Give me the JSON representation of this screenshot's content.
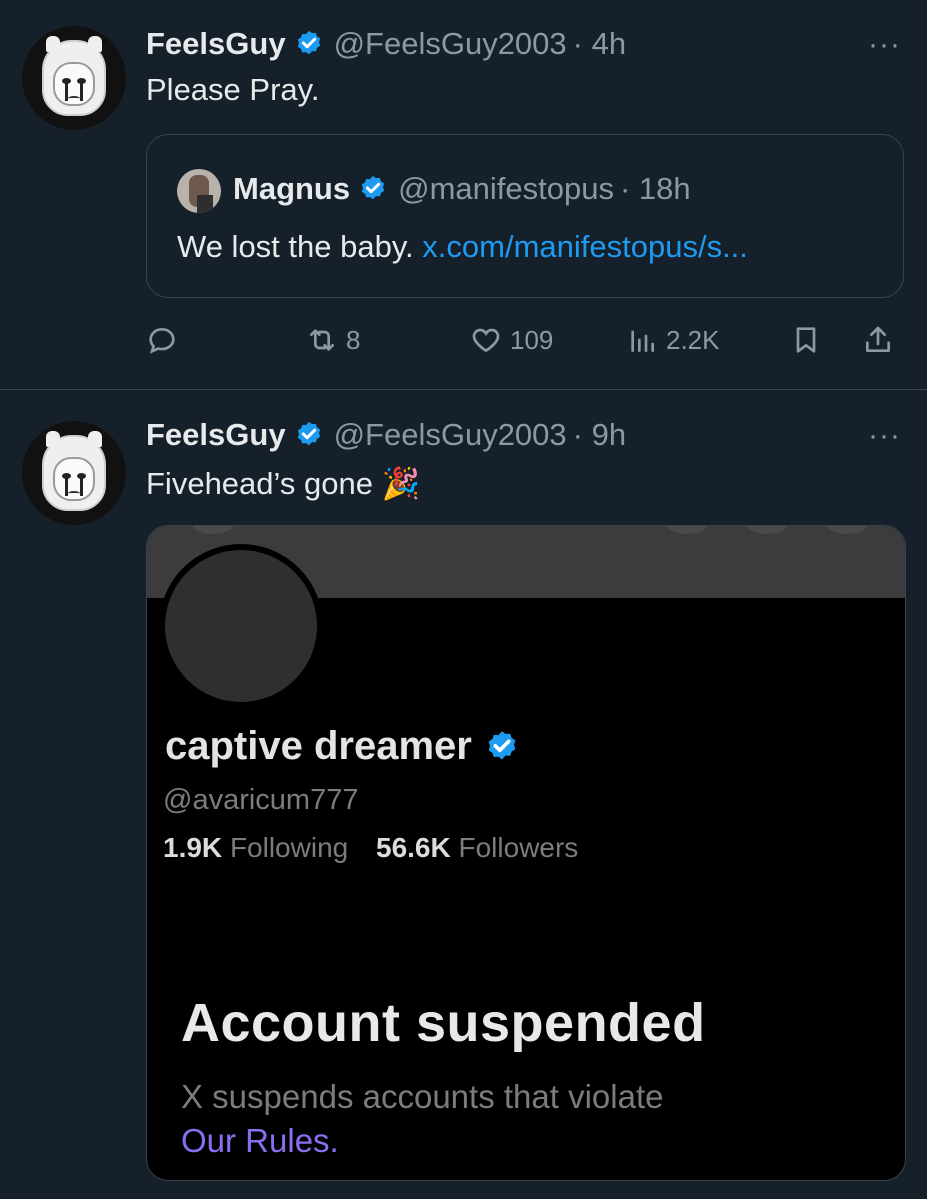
{
  "accent_color": "#1d9bf0",
  "tweets": [
    {
      "name": "FeelsGuy",
      "handle": "@FeelsGuy2003",
      "time": "· 4h",
      "text": "Please Pray.",
      "more_icon": "···",
      "quote": {
        "name": "Magnus",
        "handle": "@manifestopus",
        "time": "· 18h",
        "text": "We lost the baby.",
        "link": "x.com/manifestopus/s..."
      },
      "actions": {
        "reply": "",
        "retweet": "8",
        "like": "109",
        "views": "2.2K"
      }
    },
    {
      "name": "FeelsGuy",
      "handle": "@FeelsGuy2003",
      "time": "· 9h",
      "text": "Fivehead’s gone",
      "emoji": "🎉",
      "more_icon": "···",
      "media": {
        "profile_name": "captive dreamer",
        "profile_handle": "@avaricum777",
        "following_count": "1.9K",
        "following_label": "Following",
        "followers_count": "56.6K",
        "followers_label": "Followers",
        "status_title": "Account suspended",
        "status_desc": "X suspends accounts that violate",
        "rules_link": "Our Rules."
      }
    }
  ]
}
